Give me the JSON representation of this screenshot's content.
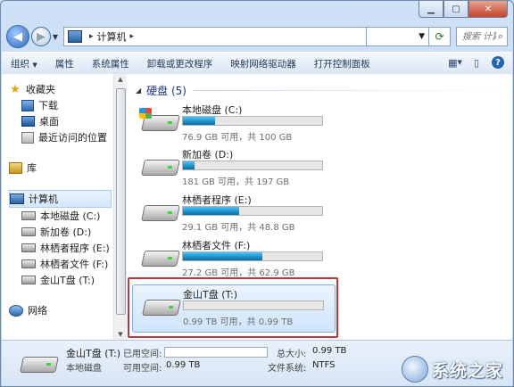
{
  "address": {
    "crumbs": [
      "计算机"
    ],
    "search_placeholder": "搜索 计算机"
  },
  "toolbar": {
    "items": [
      "组织",
      "属性",
      "系统属性",
      "卸载或更改程序",
      "映射网络驱动器",
      "打开控制面板"
    ],
    "organize_label": "组织",
    "properties_label": "属性",
    "system_properties_label": "系统属性",
    "uninstall_label": "卸载或更改程序",
    "map_drive_label": "映射网络驱动器",
    "control_panel_label": "打开控制面板"
  },
  "sidebar": {
    "favorites": "收藏夹",
    "downloads": "下载",
    "desktop": "桌面",
    "recent": "最近访问的位置",
    "libraries": "库",
    "computer": "计算机",
    "drives": [
      "本地磁盘 (C:)",
      "新加卷 (D:)",
      "林栖者程序 (E:)",
      "林栖者文件 (F:)",
      "金山T盘 (T:)"
    ],
    "network": "网络"
  },
  "main": {
    "group_title": "硬盘 (5)",
    "drives": [
      {
        "name": "本地磁盘 (C:)",
        "info": "76.9 GB 可用，共 100 GB",
        "used_fraction": 0.231,
        "system": true
      },
      {
        "name": "新加卷 (D:)",
        "info": "181 GB 可用，共 197 GB",
        "used_fraction": 0.081,
        "system": false
      },
      {
        "name": "林栖者程序 (E:)",
        "info": "29.1 GB 可用，共 48.8 GB",
        "used_fraction": 0.404,
        "system": false
      },
      {
        "name": "林栖者文件 (F:)",
        "info": "27.2 GB 可用，共 62.9 GB",
        "used_fraction": 0.568,
        "system": false
      },
      {
        "name": "金山T盘 (T:)",
        "info": "0.99 TB 可用，共 0.99 TB",
        "used_fraction": 0.0,
        "system": false
      }
    ]
  },
  "details": {
    "name": "金山T盘 (T:)",
    "type": "本地磁盘",
    "used_label": "已用空间:",
    "free_label": "可用空间:",
    "free_value": "0.99 TB",
    "total_label": "总大小:",
    "total_value": "0.99 TB",
    "fs_label": "文件系统:",
    "fs_value": "NTFS"
  },
  "watermark": "系统之家",
  "colors": {
    "accent": "#1e3287",
    "bar_fill": "#1a8fc7",
    "highlight": "#b6393f"
  }
}
